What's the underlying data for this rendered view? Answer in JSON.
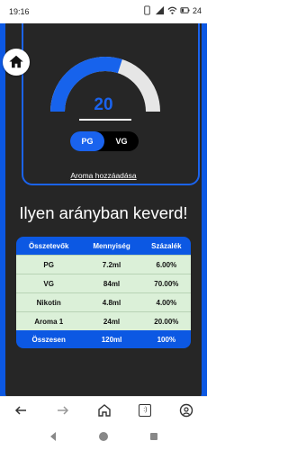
{
  "status_bar": {
    "time": "19:16",
    "battery": "24"
  },
  "app": {
    "gauge": {
      "value": "20",
      "fill_fraction": 0.6
    },
    "toggle": {
      "pg_label": "PG",
      "vg_label": "VG",
      "selected": "PG"
    },
    "aroma_link": "Aroma hozzáadása",
    "headline": "Ilyen arányban keverd!",
    "table": {
      "headers": [
        "Összetevők",
        "Mennyiség",
        "Százalék"
      ],
      "rows": [
        [
          "PG",
          "7.2ml",
          "6.00%"
        ],
        [
          "VG",
          "84ml",
          "70.00%"
        ],
        [
          "Nikotin",
          "4.8ml",
          "4.00%"
        ],
        [
          "Aroma 1",
          "24ml",
          "20.00%"
        ]
      ],
      "total": [
        "Összesen",
        "120ml",
        "100%"
      ]
    },
    "colors": {
      "accent": "#0c58e3",
      "card": "#262626",
      "row": "#dbf0d8"
    }
  },
  "browser_bar": {
    "tab_count": ":)"
  },
  "icons": [
    "home-icon",
    "back-arrow-icon",
    "forward-arrow-icon",
    "browser-home-icon",
    "tabs-icon",
    "account-icon"
  ]
}
